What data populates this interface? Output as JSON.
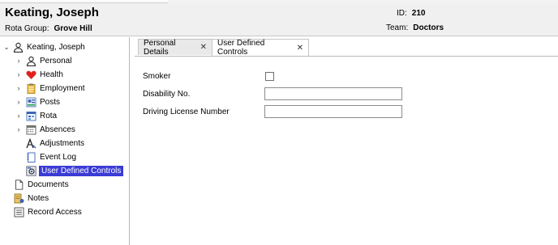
{
  "header": {
    "name": "Keating, Joseph",
    "rota_group_label": "Rota Group:",
    "rota_group_value": "Grove Hill",
    "id_label": "ID:",
    "id_value": "210",
    "team_label": "Team:",
    "team_value": "Doctors"
  },
  "tree": {
    "root": {
      "label": "Keating, Joseph",
      "icon": "person-icon"
    },
    "items": [
      {
        "label": "Personal",
        "icon": "person-icon",
        "expandable": true
      },
      {
        "label": "Health",
        "icon": "heart-icon",
        "expandable": true
      },
      {
        "label": "Employment",
        "icon": "clipboard-icon",
        "expandable": true
      },
      {
        "label": "Posts",
        "icon": "posts-icon",
        "expandable": true
      },
      {
        "label": "Rota",
        "icon": "rota-icon",
        "expandable": true
      },
      {
        "label": "Absences",
        "icon": "calendar-icon",
        "expandable": true
      },
      {
        "label": "Adjustments",
        "icon": "adjust-icon",
        "expandable": false
      },
      {
        "label": "Event Log",
        "icon": "notebook-icon",
        "expandable": false
      },
      {
        "label": "User Defined Controls",
        "icon": "controls-icon",
        "expandable": false,
        "selected": true
      }
    ],
    "bottom": [
      {
        "label": "Documents",
        "icon": "document-icon"
      },
      {
        "label": "Notes",
        "icon": "notes-icon"
      },
      {
        "label": "Record Access",
        "icon": "list-icon"
      }
    ]
  },
  "tabs": [
    {
      "label": "Personal Details",
      "active": false
    },
    {
      "label": "User Defined Controls",
      "active": true
    }
  ],
  "form": {
    "smoker_label": "Smoker",
    "disability_label": "Disability No.",
    "disability_value": "",
    "license_label": "Driving License Number",
    "license_value": ""
  },
  "colors": {
    "selection": "#3b3bd6",
    "heart": "#e02020",
    "header_bg": "#f0f0f0"
  }
}
